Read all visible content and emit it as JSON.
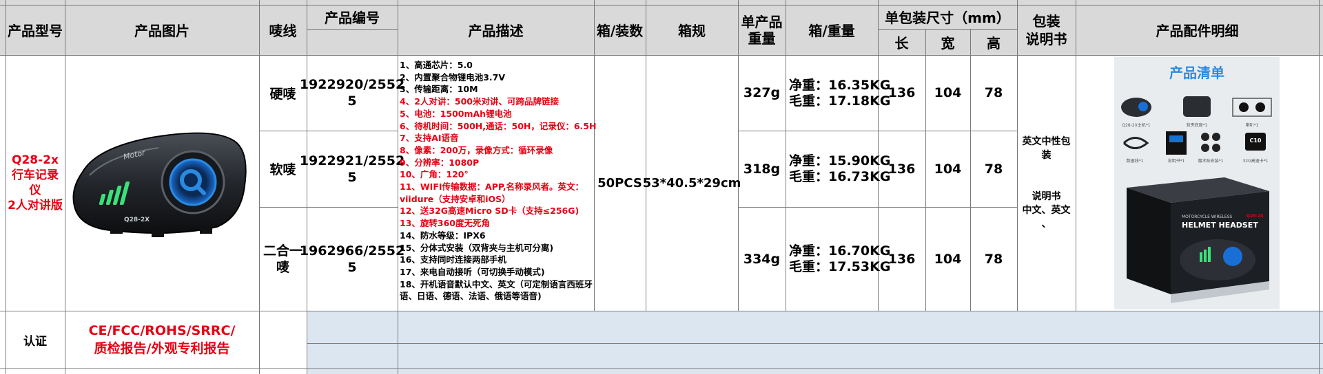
{
  "header": {
    "model": "产品型号",
    "image": "产品图片",
    "shell": "唛线",
    "code": "产品编号",
    "desc": "产品描述",
    "box_qty": "箱/装数",
    "box_spec": "箱规",
    "unit_weight": "单产品\n重量",
    "box_weight": "箱/重量",
    "pack_size": "单包装尺寸（mm）",
    "len": "长",
    "wid": "宽",
    "hei": "高",
    "manual": "包装\n说明书",
    "accessories": "产品配件明细"
  },
  "product": {
    "model": "Q28-2x\n行车记录\n仪\n2人对讲版",
    "device_brand": "Motor",
    "device_model": "Q28-2X",
    "box_qty": "50PCS",
    "box_spec": "53*40.5*29cm",
    "manual": "英文中性包\n装\n\n\n说明书\n中文、英文\n、"
  },
  "rows": [
    {
      "shell": "硬唛",
      "code": "1922920/2552\n5",
      "unit_weight": "327g",
      "net": "净重：16.35KG",
      "gross": "毛重：17.18KG",
      "len": "136",
      "wid": "104",
      "hei": "78"
    },
    {
      "shell": "软唛",
      "code": "1922921/2552\n5",
      "unit_weight": "318g",
      "net": "净重：15.90KG",
      "gross": "毛重：16.73KG",
      "len": "136",
      "wid": "104",
      "hei": "78"
    },
    {
      "shell": "二合一\n唛",
      "code": "1962966/2552\n5",
      "unit_weight": "334g",
      "net": "净重：16.70KG",
      "gross": "毛重：17.53KG",
      "len": "136",
      "wid": "104",
      "hei": "78"
    }
  ],
  "description": [
    {
      "text": "1、高通芯片：5.0",
      "red": false
    },
    {
      "text": "2、内置聚合物锂电池3.7V",
      "red": false
    },
    {
      "text": "3、传输距离：10M",
      "red": false
    },
    {
      "text": "4、2人对讲：500米对讲、可跨品牌链接",
      "red": true
    },
    {
      "text": "5、电池：1500mAh锂电池",
      "red": true
    },
    {
      "text": "6、待机时间：500H,通话：50H，记录仪：6.5H",
      "red": true
    },
    {
      "text": "7、支持AI语音",
      "red": true
    },
    {
      "text": "8、像素：200万，录像方式：循环录像",
      "red": true
    },
    {
      "text": "9、分辨率：1080P",
      "red": true
    },
    {
      "text": "10、广角：120°",
      "red": true
    },
    {
      "text": "11、WIFI传输数据：APP,名称录风者。英文：viidure（支持安卓和iOS）",
      "red": true
    },
    {
      "text": "12、送32G高速Micro SD卡（支持≤256G)",
      "red": true
    },
    {
      "text": "13、旋转360度无死角",
      "red": true
    },
    {
      "text": "14、防水等级：IPX6",
      "red": false
    },
    {
      "text": "15、分体式安装（双背夹与主机可分离)",
      "red": false
    },
    {
      "text": "16、支持同时连接两部手机",
      "red": false
    },
    {
      "text": "17、来电自动接听（可切换手动模式)",
      "red": false
    },
    {
      "text": "18、开机语音默认中文、英文（可定制语言西班牙语、日语、德语、法语、俄语等语音)",
      "red": false
    }
  ],
  "accessory_card": {
    "title": "产品清单",
    "items": [
      "Q28-2X主机*1",
      "背夹底座*1",
      "喇叭*1",
      "数据线*1",
      "说明书*1",
      "魔术贴安装*1",
      "32G高速卡*1"
    ],
    "card_label": "C10",
    "box_line1": "MOTORCYCLE WIRELESS",
    "box_line2": "HELMET HEADSET",
    "box_model": "Q28-2X"
  },
  "cert": {
    "label": "认证",
    "value": "CE/FCC/ROHS/SRRC/\n质检报告/外观专利报告"
  },
  "colors": {
    "header_bg": "#d9d9d9",
    "cert_bg": "#dce6f1",
    "red": "#e60012",
    "grid": "#7a7a7a",
    "accent_blue": "#2a8ae0"
  }
}
